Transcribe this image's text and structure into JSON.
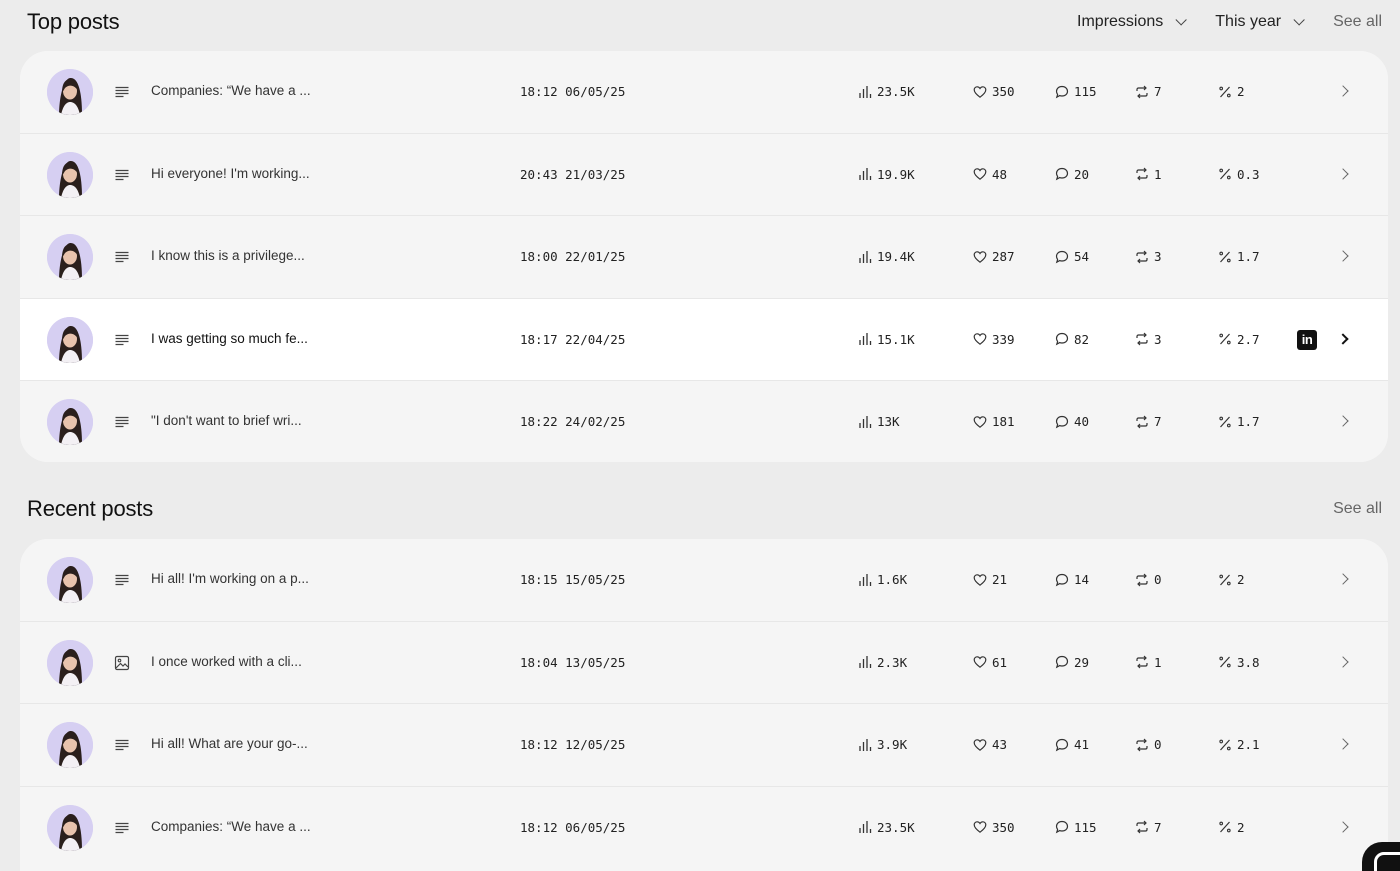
{
  "top_posts": {
    "title": "Top posts",
    "metric_dropdown": "Impressions",
    "period_dropdown": "This year",
    "see_all": "See all",
    "rows": [
      {
        "text": "Companies: “We have a ...",
        "type": "text",
        "date": "18:12 06/05/25",
        "impressions": "23.5K",
        "likes": "350",
        "comments": "115",
        "reposts": "7",
        "rate": "2"
      },
      {
        "text": "Hi everyone! I'm working...",
        "type": "text",
        "date": "20:43 21/03/25",
        "impressions": "19.9K",
        "likes": "48",
        "comments": "20",
        "reposts": "1",
        "rate": "0.3"
      },
      {
        "text": "I know this is a privilege...",
        "type": "text",
        "date": "18:00 22/01/25",
        "impressions": "19.4K",
        "likes": "287",
        "comments": "54",
        "reposts": "3",
        "rate": "1.7"
      },
      {
        "text": "I was getting so much fe...",
        "type": "text",
        "date": "18:17 22/04/25",
        "impressions": "15.1K",
        "likes": "339",
        "comments": "82",
        "reposts": "3",
        "rate": "2.7",
        "active": true,
        "badge": "in"
      },
      {
        "text": "\"I don't want to brief wri...",
        "type": "text",
        "date": "18:22 24/02/25",
        "impressions": "13K",
        "likes": "181",
        "comments": "40",
        "reposts": "7",
        "rate": "1.7"
      }
    ]
  },
  "recent_posts": {
    "title": "Recent posts",
    "see_all": "See all",
    "rows": [
      {
        "text": "Hi all! I'm working on a p...",
        "type": "text",
        "date": "18:15 15/05/25",
        "impressions": "1.6K",
        "likes": "21",
        "comments": "14",
        "reposts": "0",
        "rate": "2"
      },
      {
        "text": "I once worked with a cli...",
        "type": "image",
        "date": "18:04 13/05/25",
        "impressions": "2.3K",
        "likes": "61",
        "comments": "29",
        "reposts": "1",
        "rate": "3.8"
      },
      {
        "text": "Hi all! What are your go-...",
        "type": "text",
        "date": "18:12 12/05/25",
        "impressions": "3.9K",
        "likes": "43",
        "comments": "41",
        "reposts": "0",
        "rate": "2.1"
      },
      {
        "text": "Companies: “We have a ...",
        "type": "text",
        "date": "18:12 06/05/25",
        "impressions": "23.5K",
        "likes": "350",
        "comments": "115",
        "reposts": "7",
        "rate": "2"
      }
    ]
  },
  "icons": {
    "impressions": "bar-chart-icon",
    "likes": "heart-icon",
    "comments": "comment-icon",
    "reposts": "repost-icon",
    "rate": "percent-icon",
    "text_post": "text-lines-icon",
    "image_post": "image-icon"
  },
  "colors": {
    "background": "#ececec",
    "card": "#f5f5f5",
    "active_row": "#ffffff",
    "accent": "#111111"
  }
}
